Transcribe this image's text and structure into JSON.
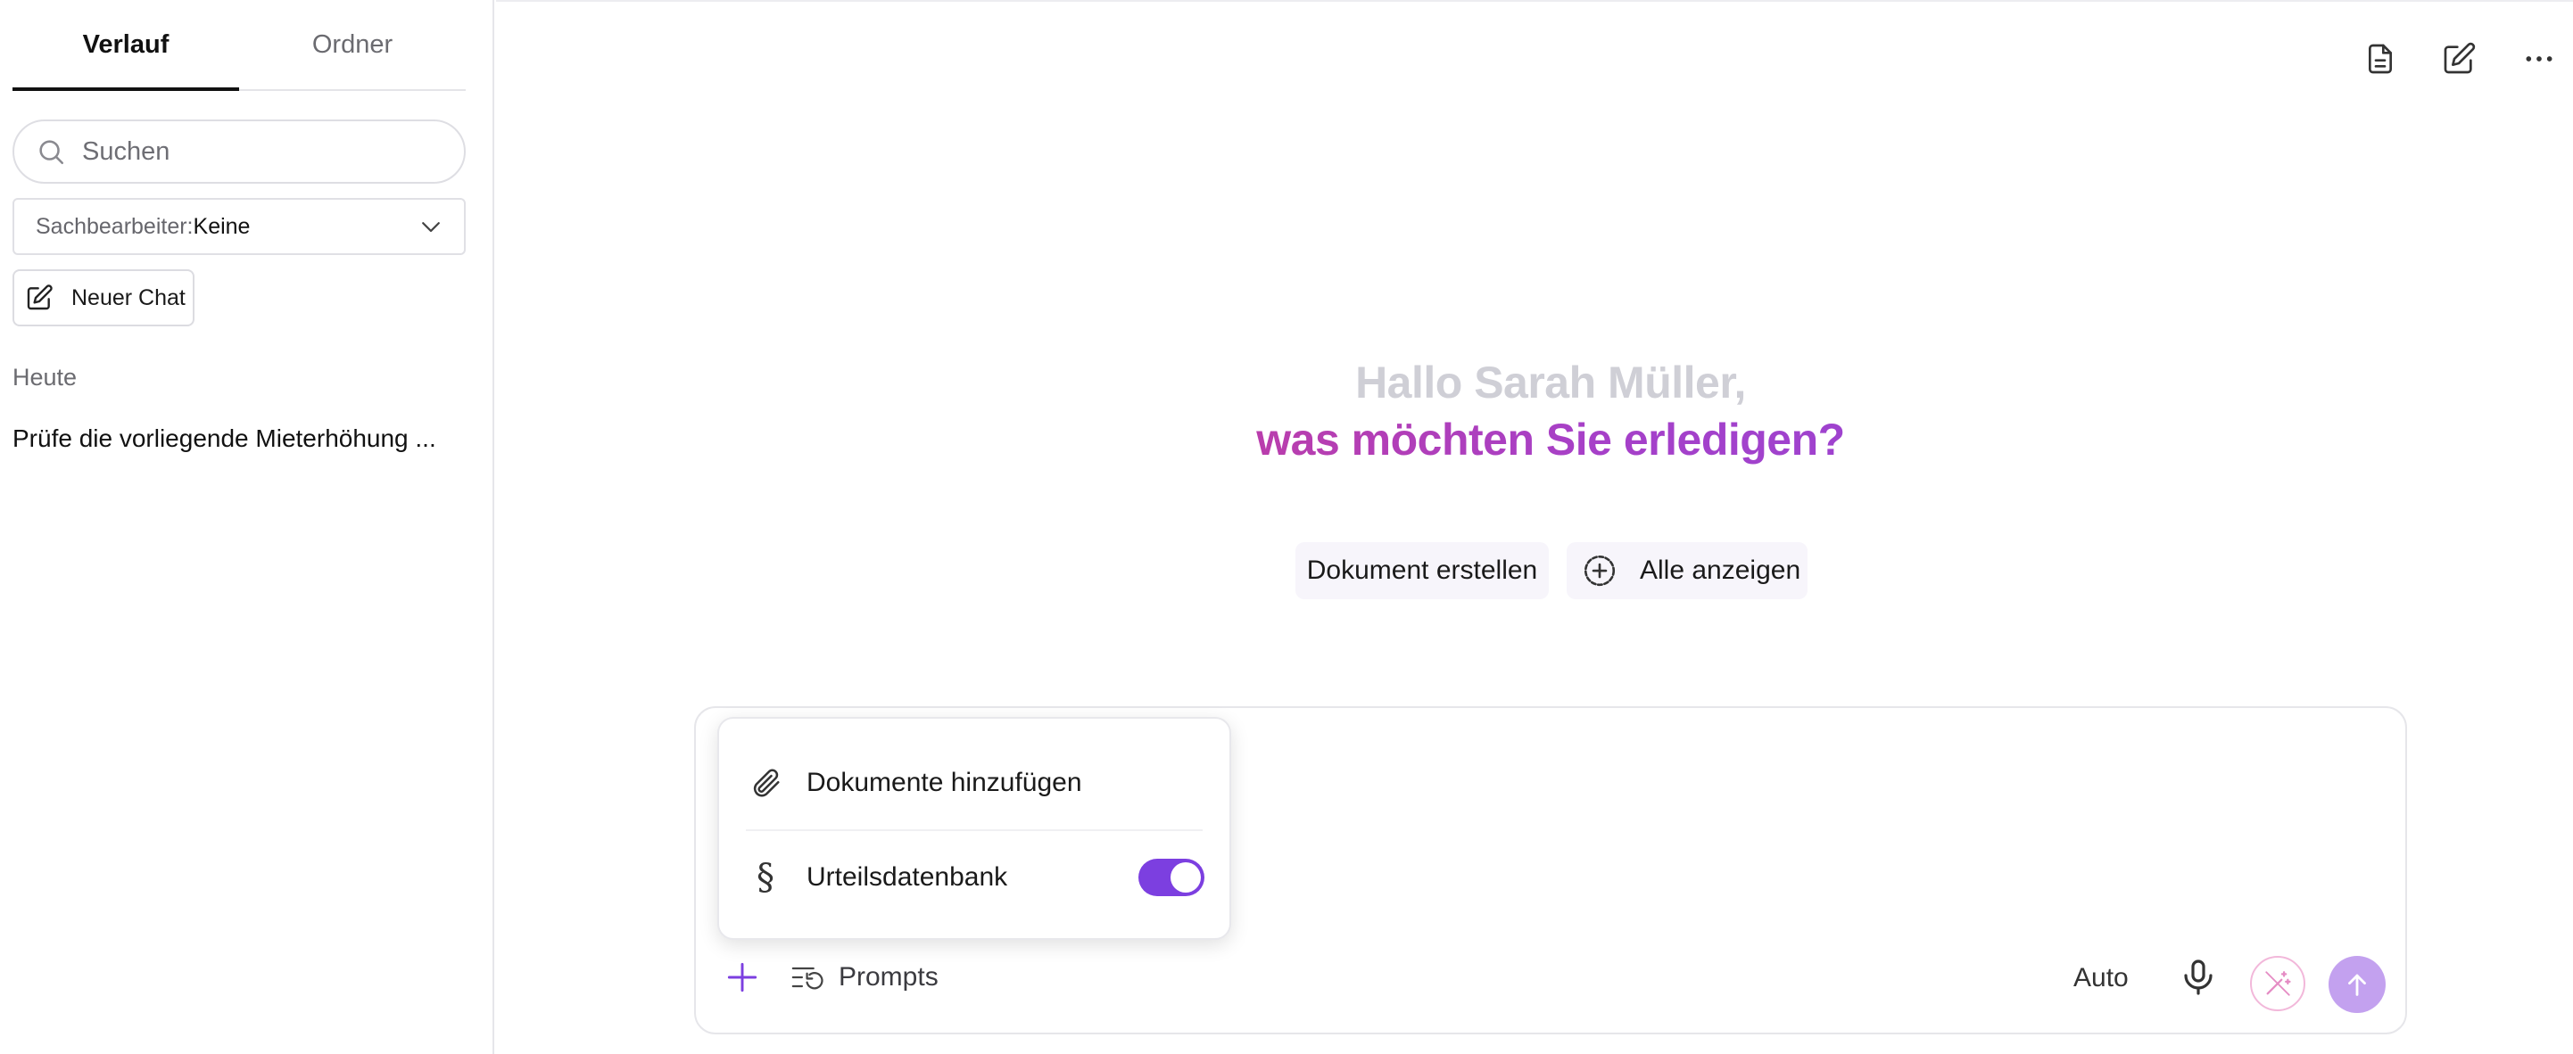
{
  "sidebar": {
    "tabs": [
      {
        "label": "Verlauf",
        "active": true
      },
      {
        "label": "Ordner",
        "active": false
      }
    ],
    "search": {
      "placeholder": "Suchen",
      "icon": "search-icon"
    },
    "caseworker_select": {
      "label": "Sachbearbeiter:",
      "value": "Keine"
    },
    "new_chat_label": "Neuer Chat",
    "section_today": "Heute",
    "history": [
      {
        "title": "Prüfe die vorliegende Mieterhöhung ..."
      }
    ]
  },
  "main": {
    "greeting_line1": "Hallo Sarah Müller,",
    "greeting_line2": "was möchten Sie erledigen?",
    "suggestions": [
      {
        "label": "Dokument erstellen"
      },
      {
        "label": "Alle anzeigen",
        "icon": "plus-circle-icon"
      }
    ],
    "composer": {
      "prompts_label": "Prompts",
      "mode_label": "Auto"
    },
    "attach_menu": {
      "items": [
        {
          "label": "Dokumente hinzufügen",
          "icon": "paperclip-icon"
        },
        {
          "label": "Urteilsdatenbank",
          "icon": "paragraph-icon",
          "symbol": "§",
          "toggle_on": true
        }
      ]
    }
  },
  "colors": {
    "accent_purple": "#7c3fe0",
    "greeting_gradient_start": "#c23ca0",
    "greeting_gradient_end": "#9a44d2",
    "greeting_muted": "#cfcfd6",
    "send_button": "#c3a1ef"
  }
}
